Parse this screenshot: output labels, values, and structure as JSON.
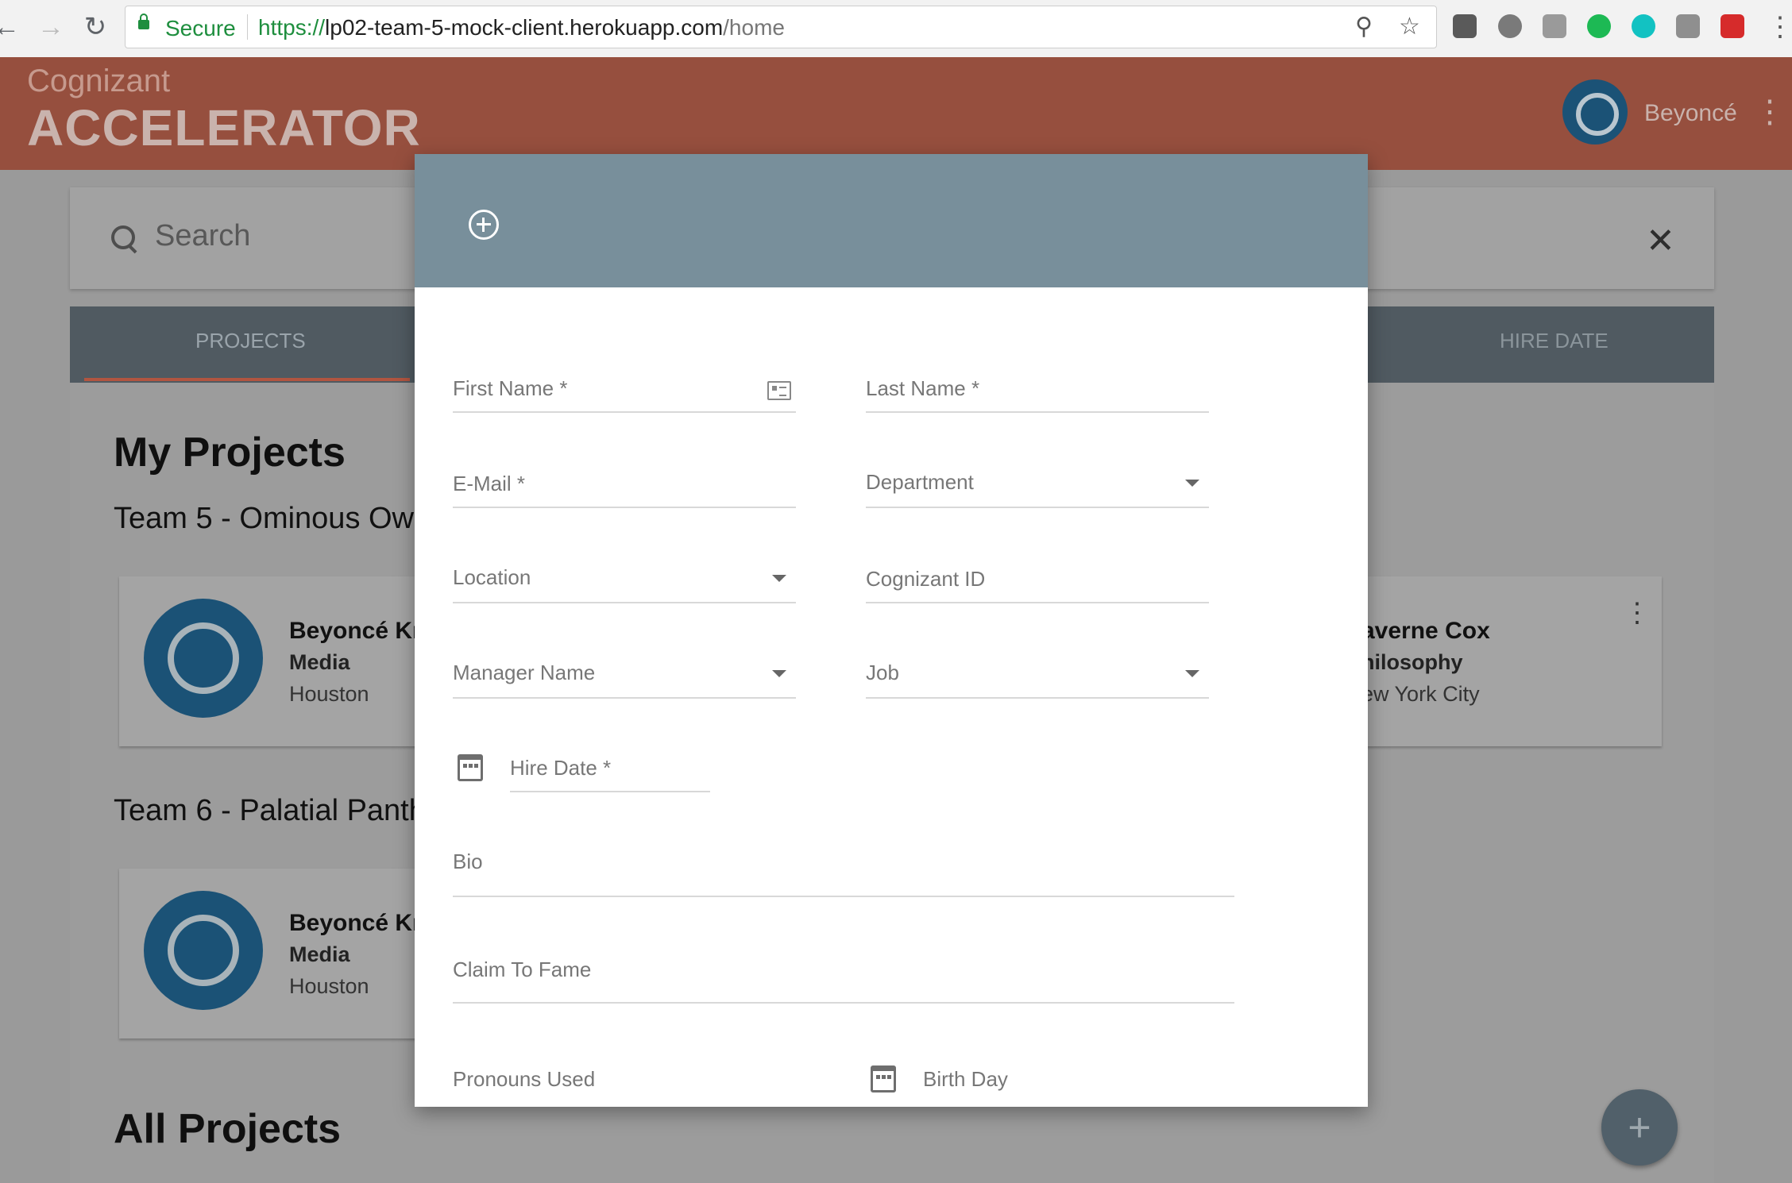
{
  "browser": {
    "secure_label": "Secure",
    "url_scheme": "https://",
    "url_host": "lp02-team-5-mock-client.herokuapp.com",
    "url_path": "/home",
    "back_icon": "arrow-left-icon",
    "forward_icon": "arrow-right-icon",
    "reload_icon": "reload-icon"
  },
  "header": {
    "logo_top": "Cognizant",
    "logo_main": "ACCELERATOR",
    "user_name": "Beyoncé",
    "bg_color": "#964f3e"
  },
  "search": {
    "placeholder": "Search"
  },
  "tabs": {
    "projects": "PROJECTS",
    "hire_date": "HIRE DATE"
  },
  "main": {
    "my_projects_title": "My Projects",
    "team5": "Team 5 - Ominous Owl",
    "team6": "Team 6 - Palatial Panth",
    "all_projects_title": "All Projects",
    "cards": [
      {
        "name": "Beyoncé Kn",
        "dept": "Media",
        "location": "Houston"
      },
      {
        "name": "averne Cox",
        "dept": "hilosophy",
        "location": "ew York City"
      },
      {
        "name": "Beyoncé Kn",
        "dept": "Media",
        "location": "Houston"
      }
    ]
  },
  "modal": {
    "header_color": "#788f9b",
    "fields": {
      "first_name": "First Name *",
      "last_name": "Last Name *",
      "email": "E-Mail *",
      "department": "Department",
      "location": "Location",
      "cognizant_id": "Cognizant ID",
      "manager_name": "Manager Name",
      "job": "Job",
      "hire_date": "Hire Date *",
      "bio": "Bio",
      "claim_to_fame": "Claim To Fame",
      "pronouns": "Pronouns Used",
      "birth_day": "Birth Day"
    }
  },
  "fab": {
    "label": "+"
  }
}
